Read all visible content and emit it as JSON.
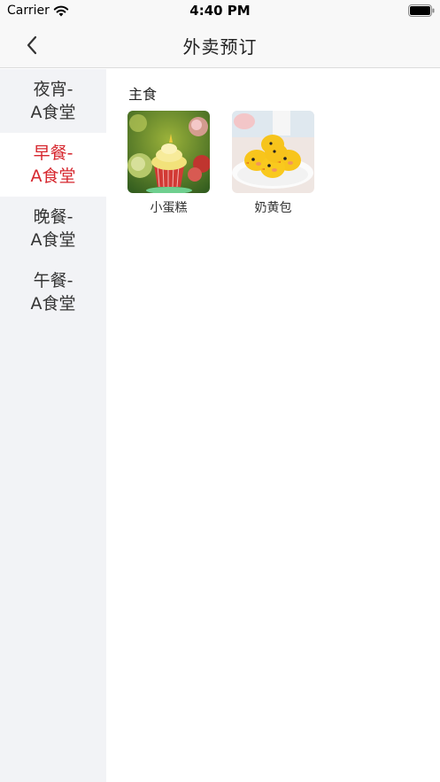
{
  "status_bar": {
    "carrier": "Carrier",
    "time": "4:40 PM"
  },
  "nav": {
    "title": "外卖预订"
  },
  "sidebar": {
    "items": [
      {
        "line1": "夜宵-",
        "line2": "A食堂",
        "active": false
      },
      {
        "line1": "早餐-",
        "line2": "A食堂",
        "active": true
      },
      {
        "line1": "晚餐-",
        "line2": "A食堂",
        "active": false
      },
      {
        "line1": "午餐-",
        "line2": "A食堂",
        "active": false
      }
    ]
  },
  "main": {
    "section_title": "主食",
    "products": [
      {
        "name": "小蛋糕",
        "icon": "cupcake-image"
      },
      {
        "name": "奶黄包",
        "icon": "custard-bun-image"
      }
    ]
  },
  "colors": {
    "accent": "#d6262d",
    "sidebar_bg": "#f2f3f6",
    "nav_bg": "#f8f8f8"
  }
}
